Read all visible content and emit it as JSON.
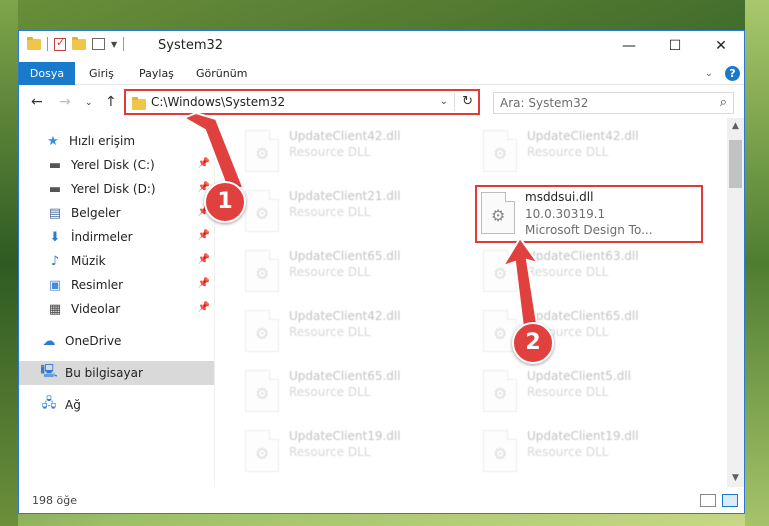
{
  "window": {
    "title": "System32",
    "controls": {
      "minimize": "—",
      "maximize": "☐",
      "close": "✕"
    }
  },
  "ribbon": {
    "tabs": [
      "Dosya",
      "Giriş",
      "Paylaş",
      "Görünüm"
    ]
  },
  "nav": {
    "address": "C:\\Windows\\System32",
    "search_placeholder": "Ara: System32"
  },
  "sidebar": {
    "items": [
      {
        "label": "Hızlı erişim",
        "icon": "star-icon"
      },
      {
        "label": "Yerel Disk (C:)",
        "icon": "drive-icon",
        "pinned": true
      },
      {
        "label": "Yerel Disk (D:)",
        "icon": "drive-icon",
        "pinned": true
      },
      {
        "label": "Belgeler",
        "icon": "documents-icon",
        "pinned": true
      },
      {
        "label": "İndirmeler",
        "icon": "download-icon",
        "pinned": true
      },
      {
        "label": "Müzik",
        "icon": "music-icon",
        "pinned": true
      },
      {
        "label": "Resimler",
        "icon": "pictures-icon",
        "pinned": true
      },
      {
        "label": "Videolar",
        "icon": "video-icon",
        "pinned": true
      },
      {
        "label": "OneDrive",
        "icon": "cloud-icon"
      },
      {
        "label": "Bu bilgisayar",
        "icon": "computer-icon",
        "selected": true
      },
      {
        "label": "Ağ",
        "icon": "network-icon"
      }
    ]
  },
  "files": {
    "left_column": [
      {
        "name": "UpdateClient42.dll",
        "type": "Resource DLL"
      },
      {
        "name": "UpdateClient21.dll",
        "type": "Resource DLL"
      },
      {
        "name": "UpdateClient65.dll",
        "type": "Resource DLL"
      },
      {
        "name": "UpdateClient42.dll",
        "type": "Resource DLL"
      },
      {
        "name": "UpdateClient65.dll",
        "type": "Resource DLL"
      },
      {
        "name": "UpdateClient19.dll",
        "type": "Resource DLL"
      }
    ],
    "right_column": [
      {
        "name": "UpdateClient42.dll",
        "type": "Resource DLL"
      },
      {
        "name": "UpdateClient63.dll",
        "type": "Resource DLL"
      },
      {
        "name": "UpdateClient65.dll",
        "type": "Resource DLL"
      },
      {
        "name": "UpdateClient5.dll",
        "type": "Resource DLL"
      },
      {
        "name": "UpdateClient19.dll",
        "type": "Resource DLL"
      }
    ],
    "highlighted": {
      "name": "msddsui.dll",
      "version": "10.0.30319.1",
      "description": "Microsoft Design To..."
    }
  },
  "status": {
    "item_count": "198 öğe"
  },
  "callouts": [
    "1",
    "2"
  ],
  "colors": {
    "accent": "#1979ca",
    "highlight": "#e03a3a"
  }
}
